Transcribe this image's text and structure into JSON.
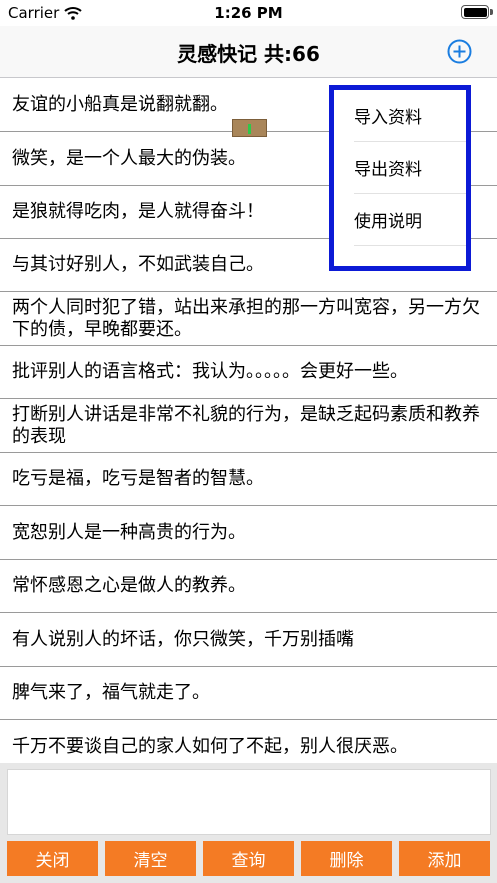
{
  "status_bar": {
    "carrier": "Carrier",
    "time": "1:26 PM",
    "wifi_icon": "wifi-icon",
    "battery_icon": "battery-icon"
  },
  "nav": {
    "title": "灵感快记  共:66",
    "add_icon": "plus-circle-icon",
    "accent_color": "#1a7de0"
  },
  "quotes": [
    "友谊的小船真是说翻就翻。",
    "微笑，是一个人最大的伪装。",
    "是狼就得吃肉，是人就得奋斗！",
    "与其讨好别人，不如武装自己。",
    "两个人同时犯了错，站出来承担的那一方叫宽容，另一方欠下的债，早晚都要还。",
    "批评别人的语言格式：我认为。。。。。会更好一些。",
    "打断别人讲话是非常不礼貌的行为，是缺乏起码素质和教养的表现",
    "吃亏是福，吃亏是智者的智慧。",
    "宽恕别人是一种高贵的行为。",
    "常怀感恩之心是做人的教养。",
    "有人说别人的坏话，你只微笑，千万别插嘴",
    "脾气来了，福气就走了。",
    "千万不要谈自己的家人如何了不起，别人很厌恶。"
  ],
  "menu": {
    "items": [
      "导入资料",
      "导出资料",
      "使用说明"
    ],
    "border_color": "#0c1ad6"
  },
  "input": {
    "value": "",
    "placeholder": ""
  },
  "buttons": {
    "close": "关闭",
    "clear": "清空",
    "query": "查询",
    "delete": "删除",
    "add": "添加",
    "color": "#f47b24"
  }
}
